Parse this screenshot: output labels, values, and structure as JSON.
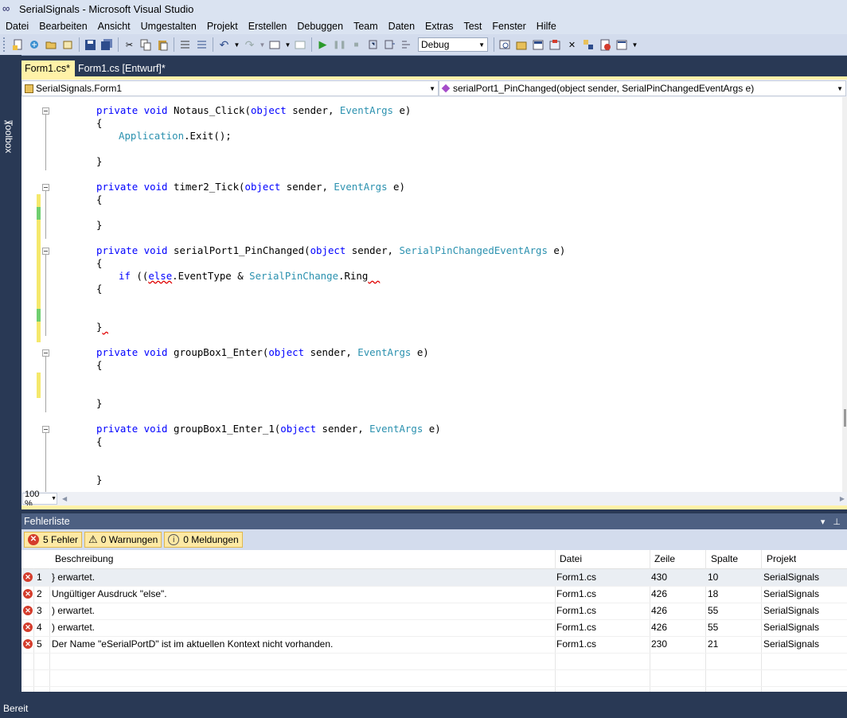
{
  "window": {
    "title": "SerialSignals - Microsoft Visual Studio"
  },
  "menu": [
    "Datei",
    "Bearbeiten",
    "Ansicht",
    "Umgestalten",
    "Projekt",
    "Erstellen",
    "Debuggen",
    "Team",
    "Daten",
    "Extras",
    "Test",
    "Fenster",
    "Hilfe"
  ],
  "toolbar": {
    "configuration": "Debug"
  },
  "toolbox": {
    "label": "Toolbox"
  },
  "tabs": [
    {
      "label": "Form1.cs*",
      "active": true
    },
    {
      "label": "Form1.cs [Entwurf]*",
      "active": false
    }
  ],
  "navbar": {
    "type_selector": "SerialSignals.Form1",
    "member_selector": "serialPort1_PinChanged(object sender, SerialPinChangedEventArgs e)"
  },
  "editor": {
    "zoom": "100 %"
  },
  "code": {
    "l1_kw": "private void ",
    "l1_name": "Notaus_Click(",
    "l1_kw2": "object",
    "l1_mid": " sender, ",
    "l1_ty": "EventArgs",
    "l1_end": " e)",
    "l2": "{",
    "l3_ty": "Application",
    "l3_rest": ".Exit();",
    "l4": "}",
    "l5_kw": "private void ",
    "l5_name": "timer2_Tick(",
    "l5_kw2": "object",
    "l5_mid": " sender, ",
    "l5_ty": "EventArgs",
    "l5_end": " e)",
    "l6": "{",
    "l7": "}",
    "l8_kw": "private void ",
    "l8_name": "serialPort1_PinChanged(",
    "l8_kw2": "object",
    "l8_mid": " sender, ",
    "l8_ty": "SerialPinChangedEventArgs",
    "l8_end": " e)",
    "l9": "{",
    "l10_kw": "if ",
    "l10_paren": "((",
    "l10_err": "else",
    "l10_mid": ".EventType & ",
    "l10_ty": "SerialPinChange",
    "l10_end": ".Ring",
    "l11": "{",
    "l12": "}",
    "l13_kw": "private void ",
    "l13_name": "groupBox1_Enter(",
    "l13_kw2": "object",
    "l13_mid": " sender, ",
    "l13_ty": "EventArgs",
    "l13_end": " e)",
    "l14": "{",
    "l15": "}",
    "l16_kw": "private void ",
    "l16_name": "groupBox1_Enter_1(",
    "l16_kw2": "object",
    "l16_mid": " sender, ",
    "l16_ty": "EventArgs",
    "l16_end": " e)",
    "l17": "{",
    "l18": "}"
  },
  "errorlist": {
    "title": "Fehlerliste",
    "filters": {
      "errors": "5 Fehler",
      "warnings": "0 Warnungen",
      "messages": "0 Meldungen"
    },
    "columns": {
      "description": "Beschreibung",
      "file": "Datei",
      "line": "Zeile",
      "column": "Spalte",
      "project": "Projekt"
    },
    "rows": [
      {
        "num": "1",
        "description": "} erwartet.",
        "file": "Form1.cs",
        "line": "430",
        "column": "10",
        "project": "SerialSignals"
      },
      {
        "num": "2",
        "description": "Ungültiger Ausdruck \"else\".",
        "file": "Form1.cs",
        "line": "426",
        "column": "18",
        "project": "SerialSignals"
      },
      {
        "num": "3",
        "description": ") erwartet.",
        "file": "Form1.cs",
        "line": "426",
        "column": "55",
        "project": "SerialSignals"
      },
      {
        "num": "4",
        "description": ") erwartet.",
        "file": "Form1.cs",
        "line": "426",
        "column": "55",
        "project": "SerialSignals"
      },
      {
        "num": "5",
        "description": "Der Name \"eSerialPortD\" ist im aktuellen Kontext nicht vorhanden.",
        "file": "Form1.cs",
        "line": "230",
        "column": "21",
        "project": "SerialSignals"
      }
    ]
  },
  "status": {
    "text": "Bereit"
  },
  "colors": {
    "chrome": "#293955",
    "active_tab": "#fff2a8",
    "keyword": "#0000ff",
    "type": "#2b91af",
    "error": "#d43c2c"
  }
}
